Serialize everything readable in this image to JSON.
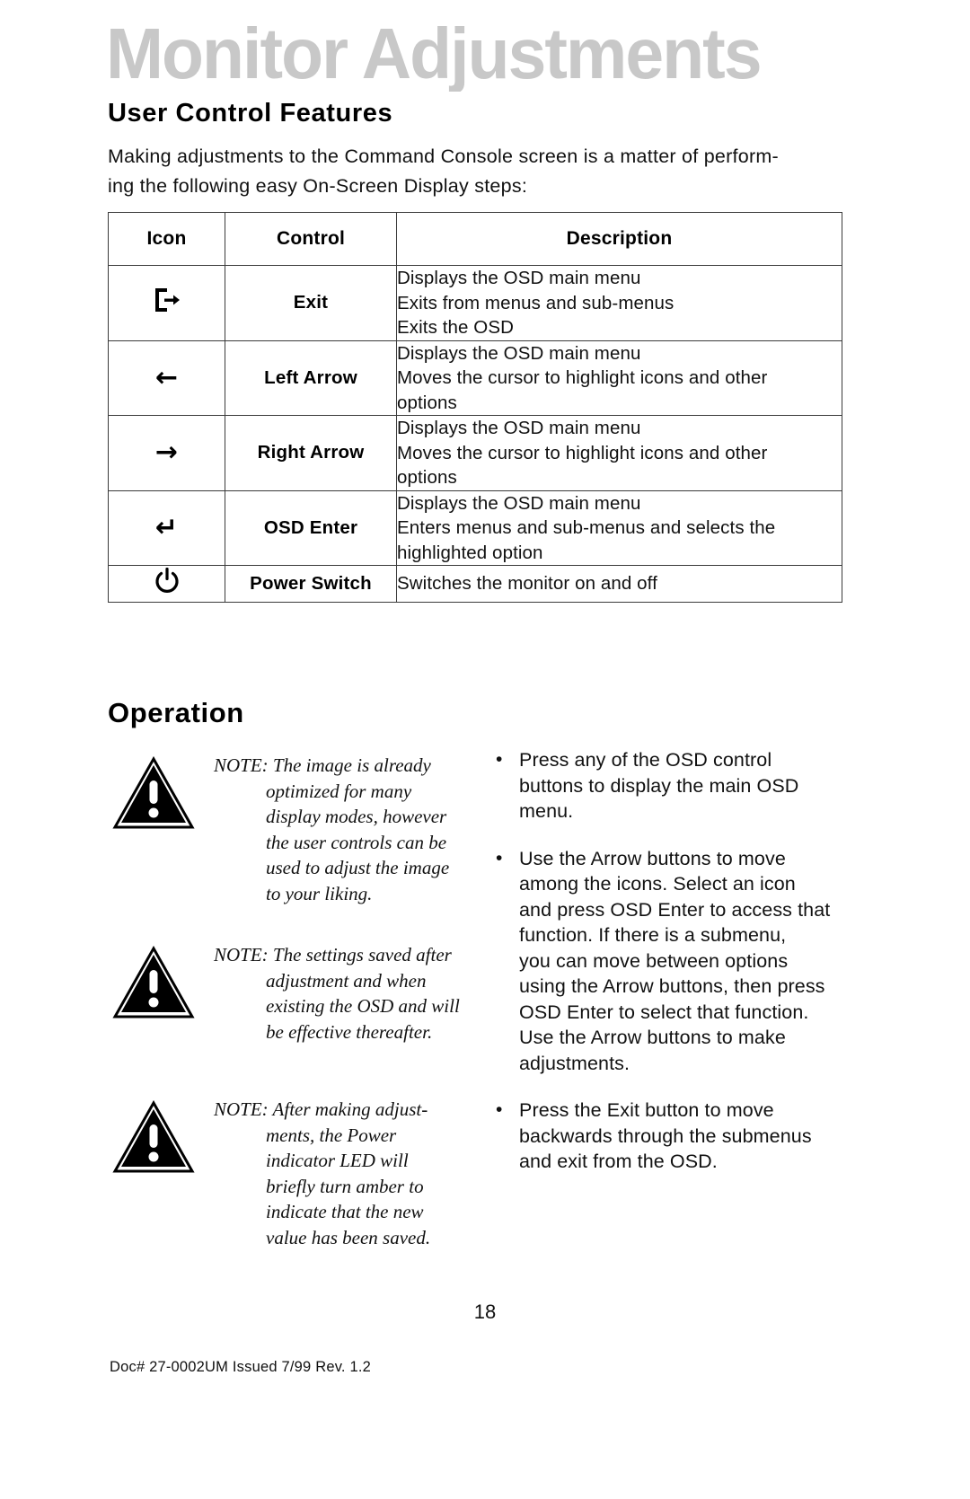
{
  "masthead": {
    "title": "Monitor Adjustments",
    "color": "#c8c8c8"
  },
  "sections": {
    "user_control_features": "User Control Features",
    "operation": "Operation"
  },
  "intro": {
    "line1": "Making adjustments to the Command Console screen is a matter of perform-",
    "line2": "ing the following easy On-Screen Display steps:"
  },
  "table": {
    "headers": {
      "icon": "Icon",
      "control": "Control",
      "description": "Description"
    },
    "rows": [
      {
        "icon_name": "exit-door-icon",
        "control": "Exit",
        "description_lines": [
          "Displays the OSD main menu",
          "Exits from menus and sub-menus",
          "Exits the OSD"
        ]
      },
      {
        "icon_name": "left-arrow-icon",
        "icon_glyph": "←",
        "control": "Left Arrow",
        "description_lines": [
          "Displays the OSD main menu",
          "Moves the cursor to highlight icons and other",
          "options"
        ]
      },
      {
        "icon_name": "right-arrow-icon",
        "icon_glyph": "→",
        "control": "Right Arrow",
        "description_lines": [
          "Displays the OSD main menu",
          "Moves the cursor to highlight icons and other",
          "options"
        ]
      },
      {
        "icon_name": "enter-return-arrow-icon",
        "icon_glyph": "↵",
        "control": "OSD Enter",
        "description_lines": [
          "Displays the OSD main menu",
          "Enters menus and sub-menus and selects the",
          "highlighted option"
        ]
      },
      {
        "icon_name": "power-symbol-icon",
        "control": "Power Switch",
        "description_lines": [
          "Switches the monitor on and off"
        ]
      }
    ]
  },
  "notes": [
    {
      "icon_name": "warning-triangle-icon",
      "lines": [
        "NOTE: The image is already",
        "optimized for many",
        "display modes, however",
        "the user controls can be",
        "used to adjust the image",
        "to your liking."
      ]
    },
    {
      "icon_name": "warning-triangle-icon",
      "lines": [
        "NOTE: The settings saved after",
        "adjustment and when",
        "existing the OSD and will",
        "be effective thereafter."
      ]
    },
    {
      "icon_name": "warning-triangle-icon",
      "lines": [
        "NOTE: After making adjust-",
        "ments, the Power",
        "indicator LED will",
        "briefly turn amber to",
        "indicate that the new",
        "value has been saved."
      ]
    }
  ],
  "bullets": [
    {
      "marker": "•",
      "lines": [
        "Press any of the OSD control",
        "buttons to display the main OSD",
        "menu."
      ]
    },
    {
      "marker": "•",
      "lines": [
        "Use the Arrow buttons to move",
        "among the icons.  Select an icon",
        "and press OSD Enter to access that",
        "function.  If there is a submenu,",
        "you can move between options",
        "using the Arrow buttons, then press",
        "OSD Enter to select that function.",
        "Use the Arrow buttons to make",
        "adjustments."
      ]
    },
    {
      "marker": "•",
      "lines": [
        "Press the Exit button to move",
        "backwards through the submenus",
        "and exit from the OSD."
      ]
    }
  ],
  "footer": {
    "page_number": "18",
    "doc_info": "Doc# 27-0002UM  Issued 7/99  Rev. 1.2"
  }
}
